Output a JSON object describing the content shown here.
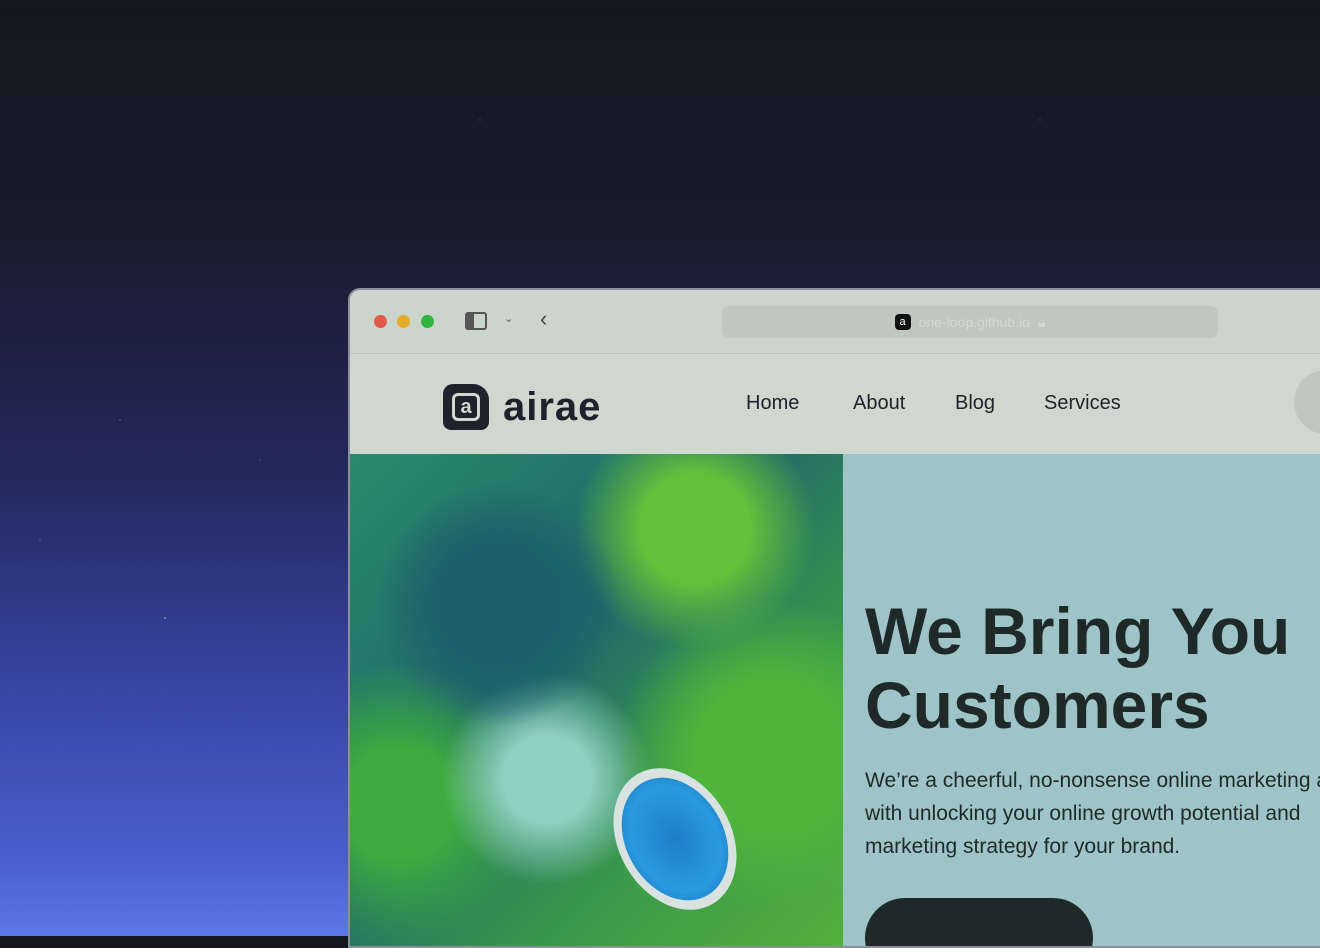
{
  "browser": {
    "url": "one-loop.github.io",
    "favicon": "a"
  },
  "site": {
    "logo_text": "airae",
    "logo_mark": "a",
    "nav": [
      {
        "label": "Home"
      },
      {
        "label": "About"
      },
      {
        "label": "Blog"
      },
      {
        "label": "Services"
      }
    ]
  },
  "hero": {
    "title_line1": "We Bring You",
    "title_line2": "Customers",
    "body_line1": "We’re a cheerful, no-nonsense online marketing agency",
    "body_line2": "with unlocking your online growth potential and",
    "body_line3": "marketing strategy for your brand."
  }
}
